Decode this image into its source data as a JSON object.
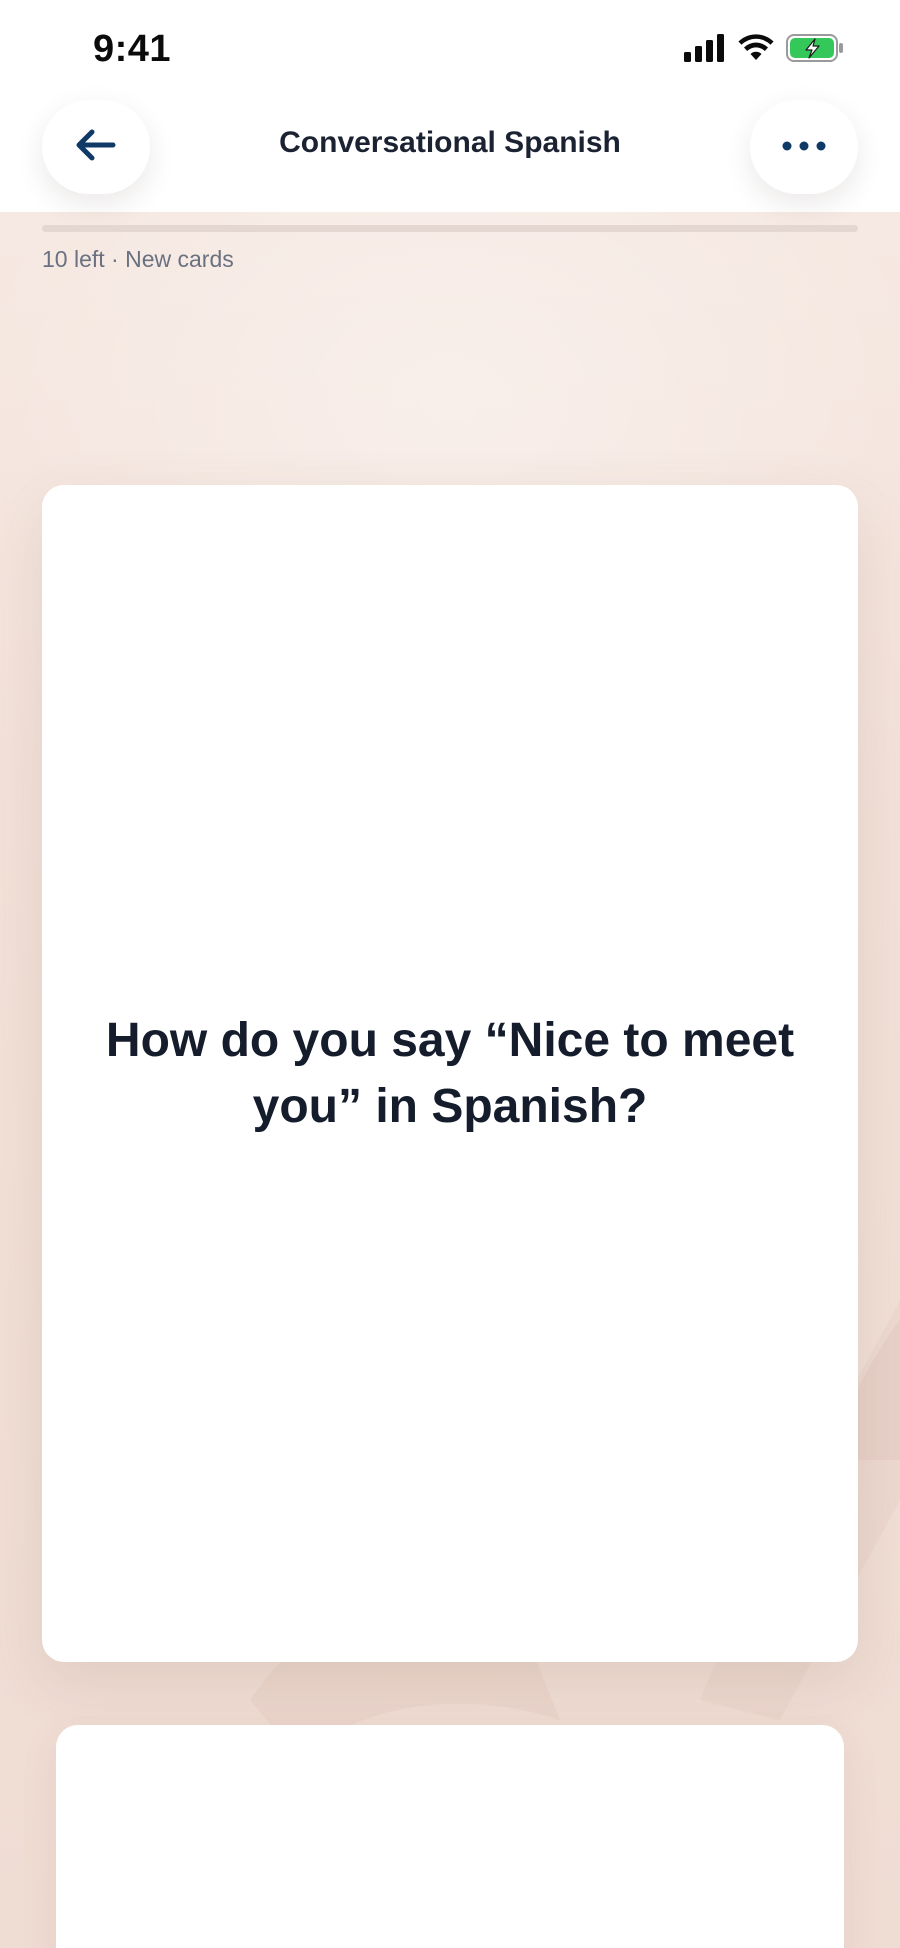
{
  "status_bar": {
    "time": "9:41",
    "icons": [
      "cellular-signal-icon",
      "wifi-icon",
      "battery-charging-icon"
    ]
  },
  "header": {
    "title": "Conversational Spanish",
    "back_icon": "arrow-left-icon",
    "more_icon": "more-horizontal-icon"
  },
  "progress": {
    "label": "10 left · New cards",
    "fraction": 0
  },
  "card": {
    "question": "How do you say “Nice to meet you” in Spanish?"
  },
  "colors": {
    "accent": "#0f3a66",
    "title_text": "#1b2333",
    "muted_text": "#6a7180",
    "background": "#f4e4dc",
    "battery": "#34c759"
  }
}
